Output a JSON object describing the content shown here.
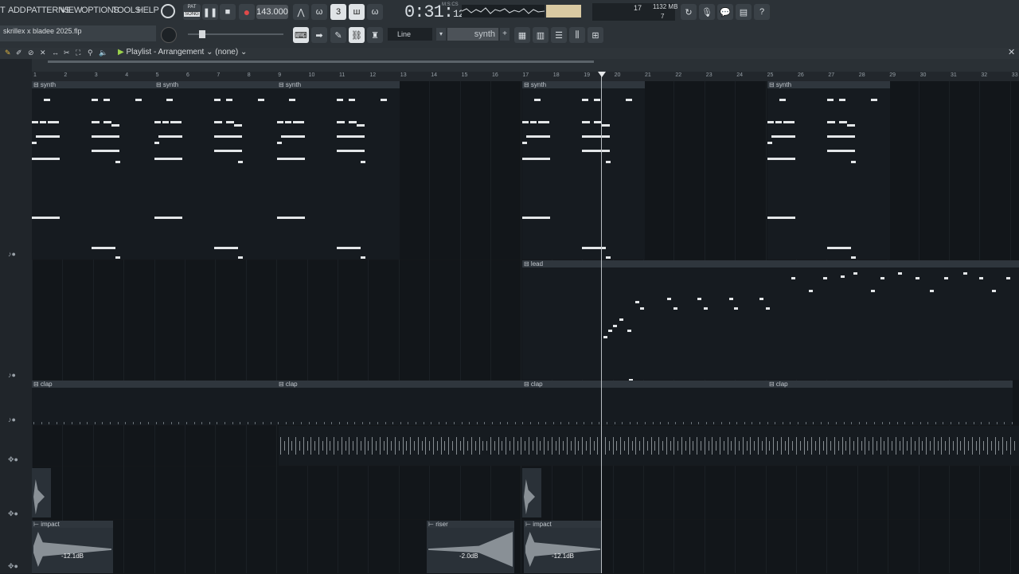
{
  "menu": [
    "T",
    "ADD",
    "PATTERNS",
    "VIEW",
    "OPTIONS",
    "TOOLS",
    "HELP"
  ],
  "transport": {
    "mode": "SONG",
    "mode_top": "PAT",
    "tempo": "143.000",
    "time_main": "0:31",
    "time_sub": "12",
    "time_label": "M:S:CS"
  },
  "stats": {
    "cpu_val": "17",
    "mem": "1132 MB",
    "poly": "7"
  },
  "project": {
    "name": "skrillex x bladee 2025.flp"
  },
  "toolbar2": {
    "line_mode": "Line",
    "pattern": "synth",
    "pattern_plus": "+"
  },
  "playlist": {
    "title": "Playlist - Arrangement",
    "arrangement": "(none)"
  },
  "ruler_marks": [
    "1",
    "2",
    "3",
    "4",
    "5",
    "6",
    "7",
    "8",
    "9",
    "10",
    "11",
    "12",
    "13",
    "14",
    "15",
    "16",
    "17",
    "18",
    "19",
    "20",
    "21",
    "22",
    "23",
    "24",
    "25",
    "26",
    "27",
    "28",
    "29",
    "30",
    "31",
    "32",
    "33"
  ],
  "clips": {
    "synth": [
      "synth",
      "synth",
      "synth",
      "synth",
      "synth"
    ],
    "lead": "lead",
    "clap": [
      "clap",
      "clap",
      "clap",
      "clap"
    ],
    "impact1": "impact",
    "impact1_db": "-12.1dB",
    "riser": "riser",
    "riser_db": "-2.0dB",
    "impact2": "impact",
    "impact2_db": "-12.1dB"
  },
  "icons": {
    "record": "record-icon",
    "play": "play-icon",
    "stop": "stop-icon",
    "help": "?"
  },
  "colors": {
    "accent": "#e04a4a",
    "note": "#e3e6e8",
    "bg": "#12161a"
  }
}
